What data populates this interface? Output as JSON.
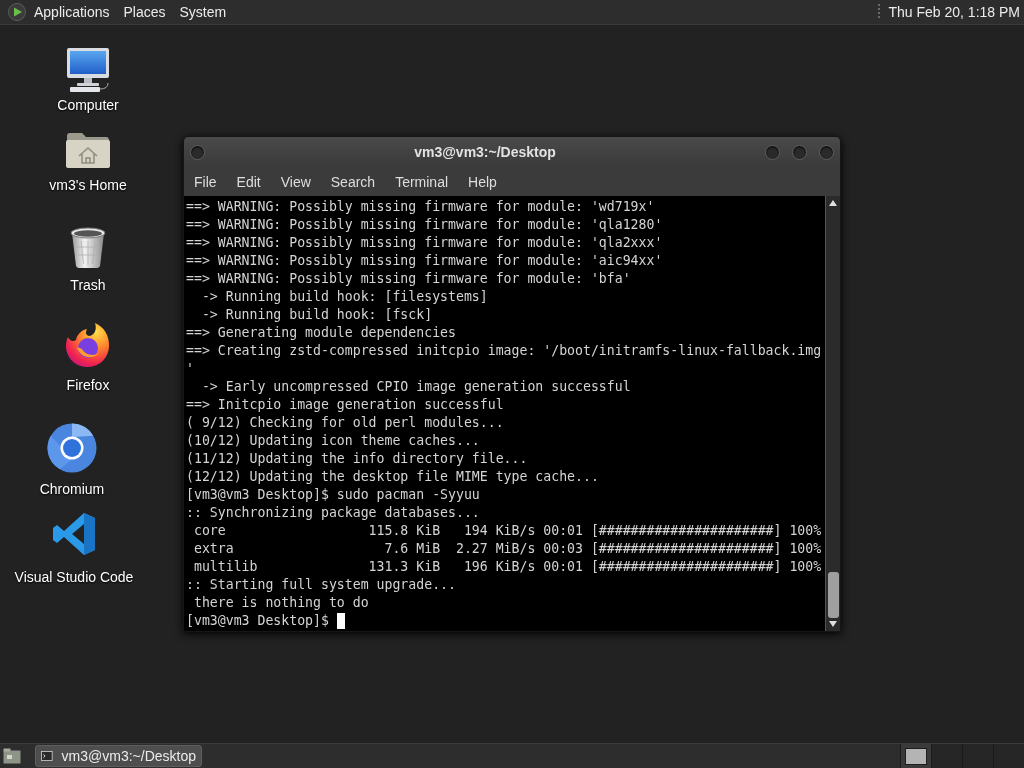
{
  "top_panel": {
    "menus": [
      "Applications",
      "Places",
      "System"
    ],
    "clock": "Thu Feb 20, 1:18 PM"
  },
  "desktop": {
    "icons": [
      {
        "label": "Computer",
        "kind": "computer"
      },
      {
        "label": "vm3's Home",
        "kind": "home"
      },
      {
        "label": "Trash",
        "kind": "trash"
      },
      {
        "label": "Firefox",
        "kind": "firefox"
      },
      {
        "label": "Chromium",
        "kind": "chromium"
      },
      {
        "label": "Visual Studio Code",
        "kind": "vscode"
      }
    ]
  },
  "terminal_window": {
    "title": "vm3@vm3:~/Desktop",
    "menus": [
      "File",
      "Edit",
      "View",
      "Search",
      "Terminal",
      "Help"
    ],
    "lines": [
      "==> WARNING: Possibly missing firmware for module: 'wd719x'",
      "==> WARNING: Possibly missing firmware for module: 'qla1280'",
      "==> WARNING: Possibly missing firmware for module: 'qla2xxx'",
      "==> WARNING: Possibly missing firmware for module: 'aic94xx'",
      "==> WARNING: Possibly missing firmware for module: 'bfa'",
      "  -> Running build hook: [filesystems]",
      "  -> Running build hook: [fsck]",
      "==> Generating module dependencies",
      "==> Creating zstd-compressed initcpio image: '/boot/initramfs-linux-fallback.img",
      "'",
      "  -> Early uncompressed CPIO image generation successful",
      "==> Initcpio image generation successful",
      "( 9/12) Checking for old perl modules...",
      "(10/12) Updating icon theme caches...",
      "(11/12) Updating the info directory file...",
      "(12/12) Updating the desktop file MIME type cache...",
      "[vm3@vm3 Desktop]$ sudo pacman -Syyuu",
      ":: Synchronizing package databases...",
      " core                  115.8 KiB   194 KiB/s 00:01 [######################] 100%",
      " extra                   7.6 MiB  2.27 MiB/s 00:03 [######################] 100%",
      " multilib              131.3 KiB   196 KiB/s 00:01 [######################] 100%",
      ":: Starting full system upgrade...",
      " there is nothing to do"
    ],
    "prompt": "[vm3@vm3 Desktop]$"
  },
  "bottom_panel": {
    "tasks": [
      {
        "label": "vm3@vm3:~/Desktop",
        "selected": true
      }
    ],
    "workspaces": [
      {
        "selected": true,
        "occupied": true
      },
      {
        "selected": false,
        "occupied": false
      },
      {
        "selected": false,
        "occupied": false
      },
      {
        "selected": false,
        "occupied": false
      }
    ]
  }
}
